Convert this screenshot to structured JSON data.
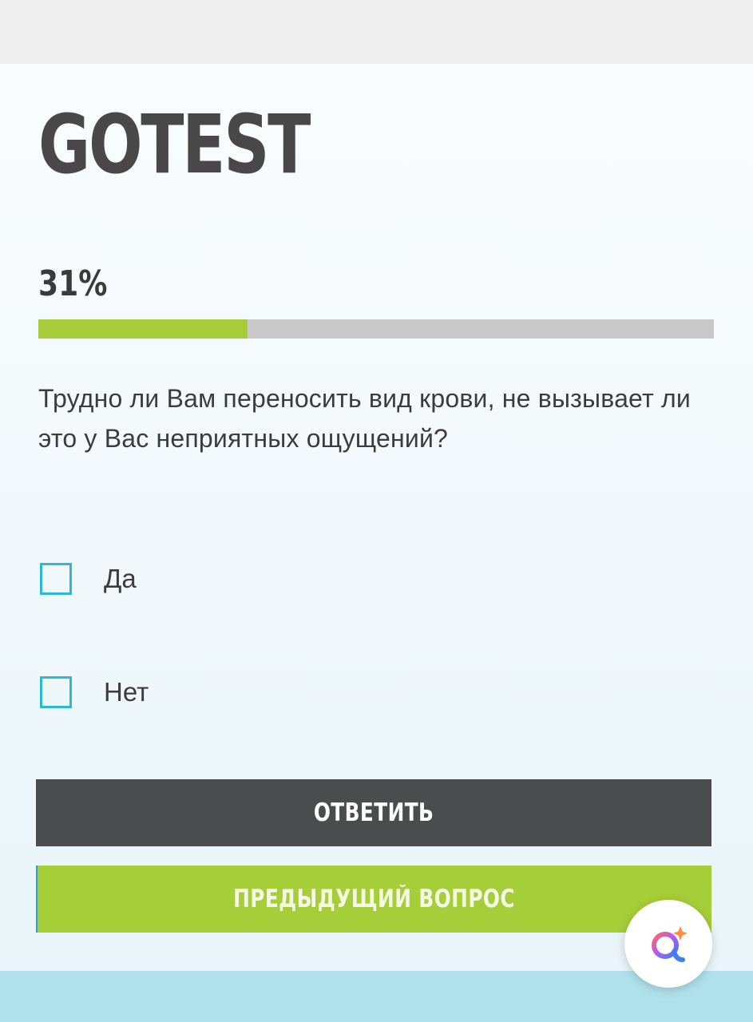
{
  "site": {
    "logo": "GOTEST"
  },
  "progress": {
    "label": "31%",
    "value": 0.31,
    "fill_color": "#a7cc39",
    "track_color": "#c9c9c9"
  },
  "question": {
    "text": "Трудно ли Вам переносить вид крови, не вызывает ли это у Вас неприятных ощущений?"
  },
  "options": [
    {
      "label": "Да",
      "checked": false
    },
    {
      "label": "Нет",
      "checked": false
    }
  ],
  "buttons": {
    "answer_label": "ОТВЕТИТЬ",
    "previous_label": "ПРЕДЫДУЩИЙ ВОПРОС"
  },
  "colors": {
    "accent_green": "#a6ce38",
    "dark_button": "#4a4c4e",
    "checkbox_border": "#2bbad4",
    "footer": "#b0e2ed"
  },
  "icons": {
    "fab": "assistant-search-icon"
  }
}
